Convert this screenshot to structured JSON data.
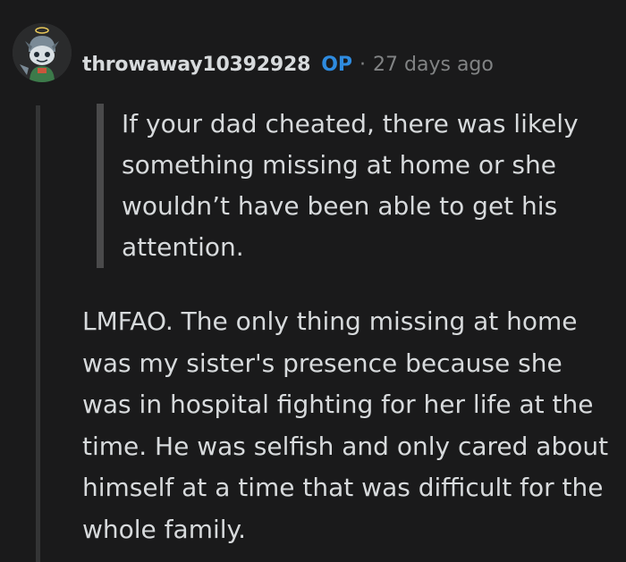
{
  "comment": {
    "author": "throwaway10392928",
    "op_badge": "OP",
    "separator": "·",
    "timestamp": "27 days ago",
    "quote": "If your dad cheated, there was likely something missing at home or she wouldn’t have been able to get his attention.",
    "body": "LMFAO. The only thing missing at home was my sister's presence because she was in hospital fighting for her life at the time. He was selfish and only cared about himself at a time that was difficult for the whole family."
  },
  "icons": {
    "avatar": "snoo-avatar-icon"
  },
  "colors": {
    "background": "#1a1a1b",
    "text": "#d7dadc",
    "muted": "#818384",
    "op_accent": "#2e8bdf",
    "thread_line": "#343536",
    "quote_bar": "#4a4a4b"
  }
}
